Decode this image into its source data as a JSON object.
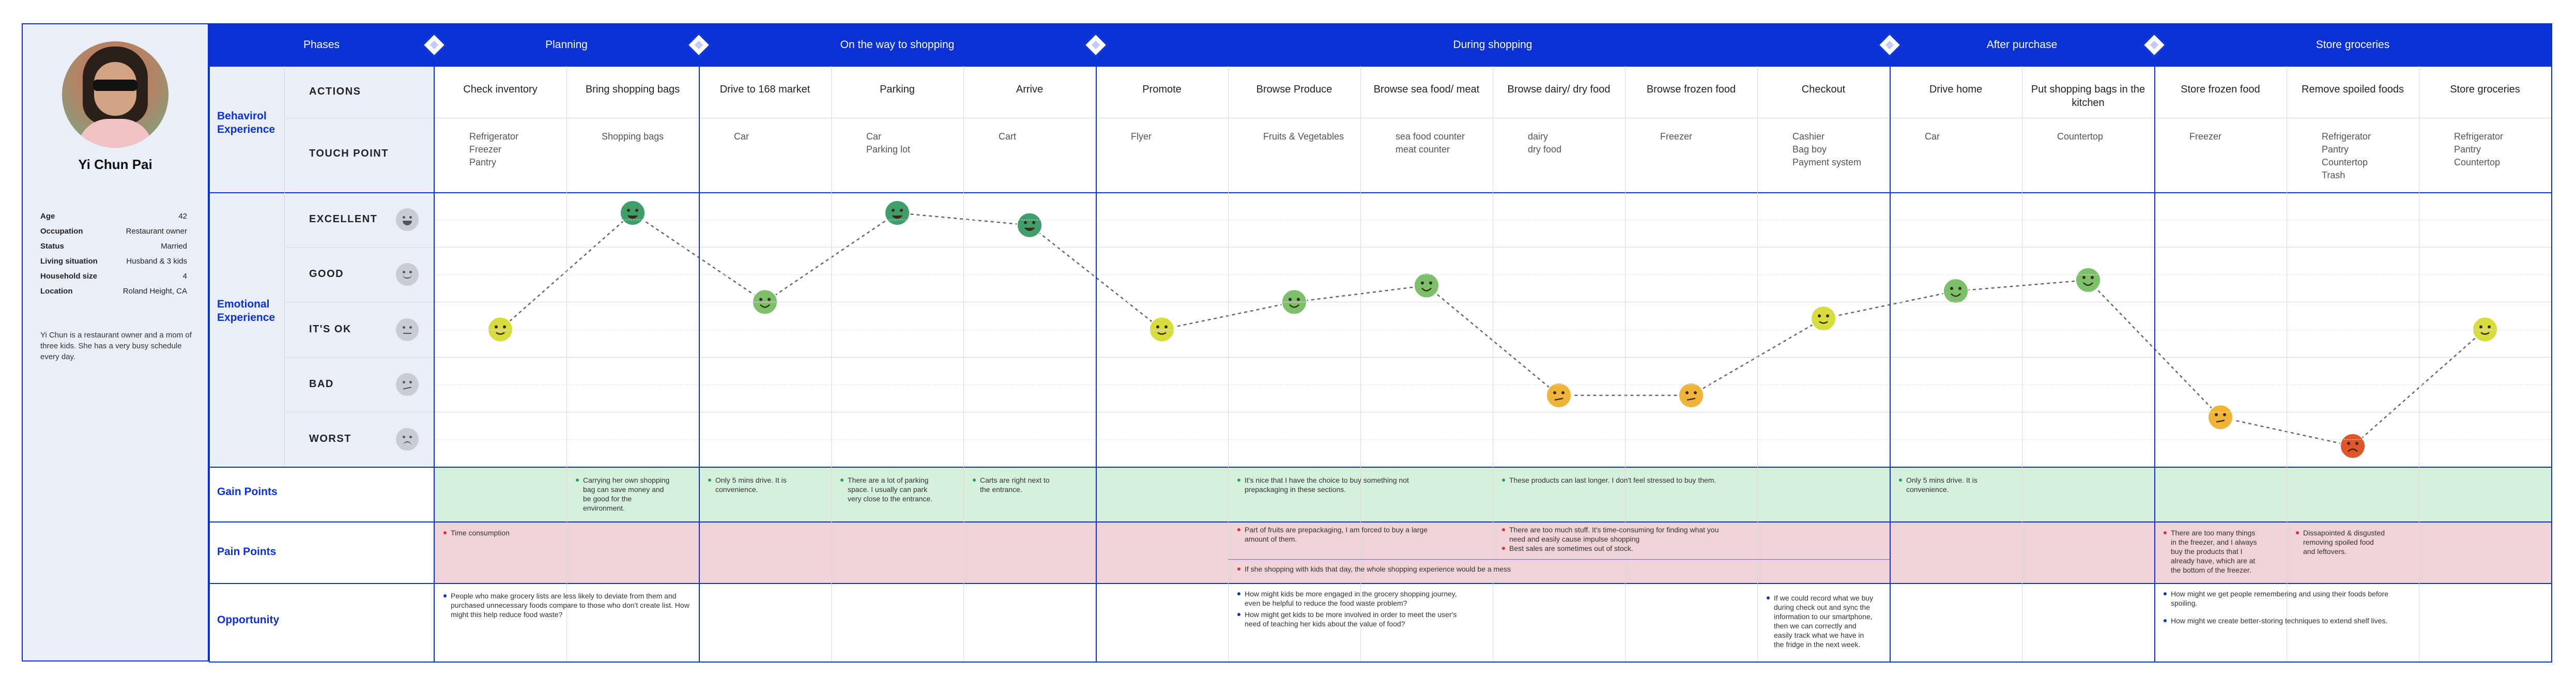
{
  "persona": {
    "name": "Yi Chun Pai",
    "fields": [
      {
        "label": "Age",
        "value": "42"
      },
      {
        "label": "Occupation",
        "value": "Restaurant owner"
      },
      {
        "label": "Status",
        "value": "Married"
      },
      {
        "label": "Living situation",
        "value": "Husband & 3 kids"
      },
      {
        "label": "Household size",
        "value": "4"
      },
      {
        "label": "Location",
        "value": "Roland Height, CA"
      }
    ],
    "bio": "Yi Chun is a restaurant owner and a mom of three kids. She has a very busy schedule every day."
  },
  "header": {
    "phases_label": "Phases",
    "phases": [
      "Planning",
      "On the way to shopping",
      "During shopping",
      "After purchase",
      "Store groceries"
    ]
  },
  "sections": {
    "behavioral": "Behavirol Experience",
    "emotional": "Emotional Experience",
    "gain": "Gain Points",
    "pain": "Pain Points",
    "opportunity": "Opportunity"
  },
  "rows": {
    "actions": "ACTIONS",
    "touch_point": "TOUCH POINT"
  },
  "emotion_levels": [
    "EXCELLENT",
    "GOOD",
    "IT'S OK",
    "BAD",
    "WORST"
  ],
  "steps": [
    {
      "action": "Check inventory",
      "touch": "Refrigerator\nFreezer\nPantry",
      "emotion": 2.5
    },
    {
      "action": "Bring shopping bags",
      "touch": "Shopping bags",
      "emotion": 4.7
    },
    {
      "action": "Drive to 168 market",
      "touch": "Car",
      "emotion": 3.0
    },
    {
      "action": "Parking",
      "touch": "Car\nParking lot",
      "emotion": 4.9
    },
    {
      "action": "Arrive",
      "touch": "Cart",
      "emotion": 4.4
    },
    {
      "action": "Promote",
      "touch": "Flyer",
      "emotion": 2.5
    },
    {
      "action": "Browse Produce",
      "touch": "Fruits & Vegetables",
      "emotion": 3.0
    },
    {
      "action": "Browse sea food/ meat",
      "touch": "sea food counter\nmeat counter",
      "emotion": 3.3
    },
    {
      "action": "Browse dairy/ dry food",
      "touch": "dairy\ndry food",
      "emotion": 1.3
    },
    {
      "action": "Browse frozen food",
      "touch": "Freezer",
      "emotion": 1.3
    },
    {
      "action": "Checkout",
      "touch": "Cashier\nBag boy\nPayment system",
      "emotion": 2.7
    },
    {
      "action": "Drive home",
      "touch": "Car",
      "emotion": 3.2
    },
    {
      "action": "Put shopping bags in the kitchen",
      "touch": "Countertop",
      "emotion": 3.4
    },
    {
      "action": "Store frozen food",
      "touch": "Freezer",
      "emotion": 0.9
    },
    {
      "action": "Remove spoiled foods",
      "touch": "Refrigerator\nPantry\nCountertop\nTrash",
      "emotion": 0.1
    },
    {
      "action": "Store groceries",
      "touch": "Refrigerator\nPantry\nCountertop",
      "emotion": 2.5
    }
  ],
  "gain_points": [
    {
      "text": "Carrying her own shopping bag can save money and be good for the environment."
    },
    {
      "text": "Only 5 mins drive. It is convenience."
    },
    {
      "text": "There are a lot of parking space. I usually can park very close to the entrance."
    },
    {
      "text": "Carts are right next to the entrance."
    },
    {
      "text": "It's nice that I have the choice to buy something not prepackaging in these sections."
    },
    {
      "text": "These products can last longer. I don't feel stressed to buy them."
    },
    {
      "text": "Only 5 mins drive. It is convenience."
    }
  ],
  "pain_points": [
    {
      "text": "Time consumption"
    },
    {
      "text": "Part of fruits are prepackaging, I am forced to buy a large amount of them."
    },
    {
      "text": "There are too much stuff. It's time-consuming for finding what you need and easily cause impulse shopping"
    },
    {
      "text": "Best sales are sometimes out of stock."
    },
    {
      "text": "If she shopping with kids that day, the whole shopping experience would be a mess"
    },
    {
      "text": "There are too many things in the freezer, and I always buy the products that I already have, which are at the bottom of the freezer."
    },
    {
      "text": "Dissapointed & disgusted removing spoiled food and leftovers."
    }
  ],
  "opportunities": [
    {
      "text": "People who make grocery lists are less likely to deviate from them and purchased unnecessary foods compare to those who don't create list. How might this help reduce food waste?"
    },
    {
      "text": "How might kids be more engaged in the grocery shopping journey, even be helpful to reduce the food waste problem?"
    },
    {
      "text": "How might get kids to be more involved in order to meet the user's need of teaching her kids about the value of food?"
    },
    {
      "text": "If we could record what we buy during check out and sync the information to our smartphone, then we can correctly and easily track what we have in the fridge in the next week."
    },
    {
      "text": "How might we get people remembering and using their foods before spoiling."
    },
    {
      "text": "How might we create better-storing techniques to extend shelf lives."
    }
  ],
  "colors": {
    "brand_blue": "#0a31d6",
    "gain_bg": "#d6f0de",
    "pain_bg": "#efd3d8",
    "excellent": "#3f9e6a",
    "good": "#7cc06a",
    "ok": "#d6dd3c",
    "bad": "#f0b43a",
    "worst": "#e0562b"
  }
}
